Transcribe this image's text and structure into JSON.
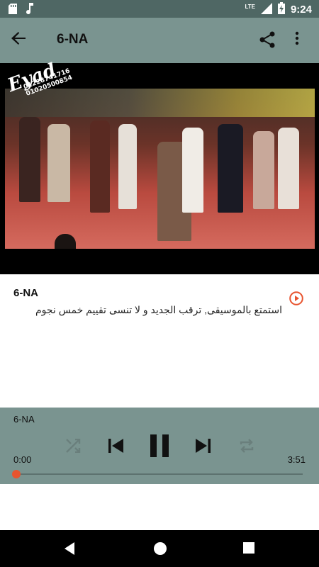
{
  "status_bar": {
    "time": "9:24",
    "network": "LTE",
    "icons": [
      "sd-card-icon",
      "music-note-icon",
      "signal-icon",
      "battery-charging-icon"
    ]
  },
  "app_bar": {
    "title": "6-NA",
    "back_icon": "arrow-back-icon",
    "share_icon": "share-icon",
    "menu_icon": "more-vert-icon"
  },
  "video": {
    "watermark_brand": "Eyad",
    "watermark_phone_1": "01228741716",
    "watermark_phone_2": "01020500854"
  },
  "track": {
    "title": "6-NA",
    "description": "استمتع بالموسيقى, ترقب الجديد و لا تنسى تقييم خمس نجوم"
  },
  "player": {
    "title": "6-NA",
    "current_time": "0:00",
    "total_time": "3:51",
    "progress": 0,
    "accent_color": "#e8542f"
  },
  "colors": {
    "app_bar": "#7a9490",
    "status_bar": "#4f6764",
    "accent": "#e8542f"
  }
}
